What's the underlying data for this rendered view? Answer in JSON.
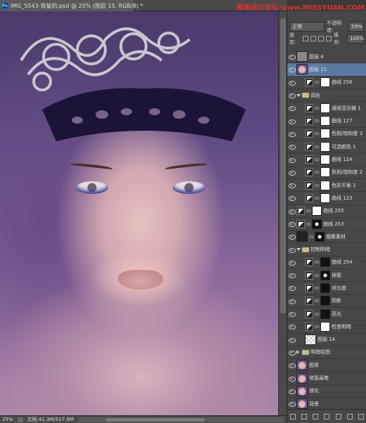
{
  "document": {
    "tab_title": "IMG_5543-恢复的.psd @ 25% (图层 15, RGB/8) *",
    "app_logo": "Ps"
  },
  "watermark": "思缘设计论坛 www.MISSYUAN.COM",
  "status": {
    "zoom": "25%",
    "doc_info": "文档:41.3M/517.8M"
  },
  "layers_panel": {
    "blend_mode": "正常",
    "opacity_label": "不透明度:",
    "opacity_value": "59%",
    "lock_label": "锁定:",
    "fill_label": "填充:",
    "fill_value": "100%",
    "layers": [
      {
        "name": "图层 4"
      },
      {
        "name": "图层 15",
        "selected": true
      },
      {
        "name": "曲线 256"
      },
      {
        "name": "调色"
      },
      {
        "name": "通道混合器 1"
      },
      {
        "name": "曲线 127"
      },
      {
        "name": "色相/饱和度 3"
      },
      {
        "name": "可选颜色 1"
      },
      {
        "name": "曲线 124"
      },
      {
        "name": "色相/饱和度 2"
      },
      {
        "name": "色彩平衡 1"
      },
      {
        "name": "曲线 123"
      },
      {
        "name": "曲线 255"
      },
      {
        "name": "曲线 253"
      },
      {
        "name": "烟雾素材"
      },
      {
        "name": "控制明暗"
      },
      {
        "name": "曲线 254"
      },
      {
        "name": "保密"
      },
      {
        "name": "对比度"
      },
      {
        "name": "阴影"
      },
      {
        "name": "高光"
      },
      {
        "name": "检查明暗"
      },
      {
        "name": "图层 14"
      },
      {
        "name": "明暗绘图"
      },
      {
        "name": "图章"
      },
      {
        "name": "修复画笔"
      },
      {
        "name": "液化"
      },
      {
        "name": "背景"
      }
    ]
  },
  "colors": {
    "panel_bg": "#474747",
    "selected_layer": "#5b7aa3",
    "watermark": "#e03030"
  }
}
